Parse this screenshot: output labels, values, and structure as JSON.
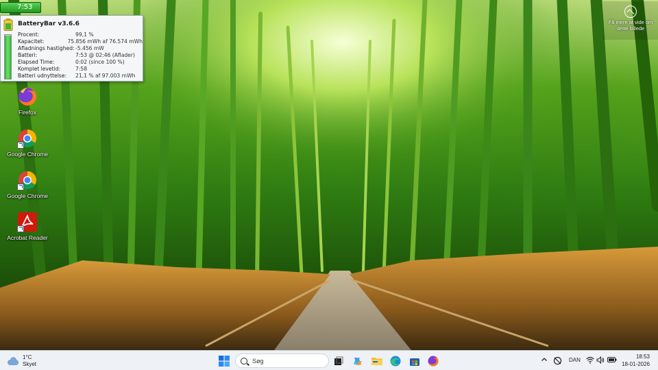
{
  "battery_tray": {
    "time": "7:53"
  },
  "battery_popup": {
    "title": "BatteryBar v3.6.6",
    "level_percent": 99.1,
    "rows": [
      {
        "label": "Procent:",
        "value": "99,1 %"
      },
      {
        "label": "Kapacitet:",
        "value": "75.856 mWh af 76.574 mWh"
      },
      {
        "label": "Afladnings hastighed:",
        "value": "-5.456 mW"
      },
      {
        "label": "Batteri:",
        "value": "7:53 @ 02:46 (Aflader)"
      },
      {
        "label": "Elapsed Time:",
        "value": "0:02 (since 100 %)"
      },
      {
        "label": "Komplet levetid:",
        "value": "7:58"
      },
      {
        "label": "Batteri udnyttelse:",
        "value": "21,1 % af 97.003 mWh"
      }
    ]
  },
  "desktop_icons": [
    {
      "label": "Firefox",
      "icon": "firefox-icon"
    },
    {
      "label": "Google Chrome",
      "icon": "chrome-icon"
    },
    {
      "label": "Google Chrome",
      "icon": "chrome-icon"
    },
    {
      "label": "Acrobat Reader",
      "icon": "acrobat-icon"
    }
  ],
  "spotlight": {
    "line1": "Få mere at vide om",
    "line2": "dette billede"
  },
  "taskbar": {
    "weather": {
      "temp": "1°C",
      "condition": "Skyet"
    },
    "search_placeholder": "Søg",
    "apps": [
      "start-icon",
      "task-view-icon",
      "copilot-icon",
      "file-explorer-icon",
      "edge-icon",
      "store-icon",
      "firefox-icon"
    ],
    "language": "DAN",
    "time": "18:53",
    "date": "18-01-2026"
  },
  "colors": {
    "taskbar_bg": "#eef1f6",
    "battery_green": "#2eb72e",
    "accent_blue": "#1a6fd6"
  }
}
